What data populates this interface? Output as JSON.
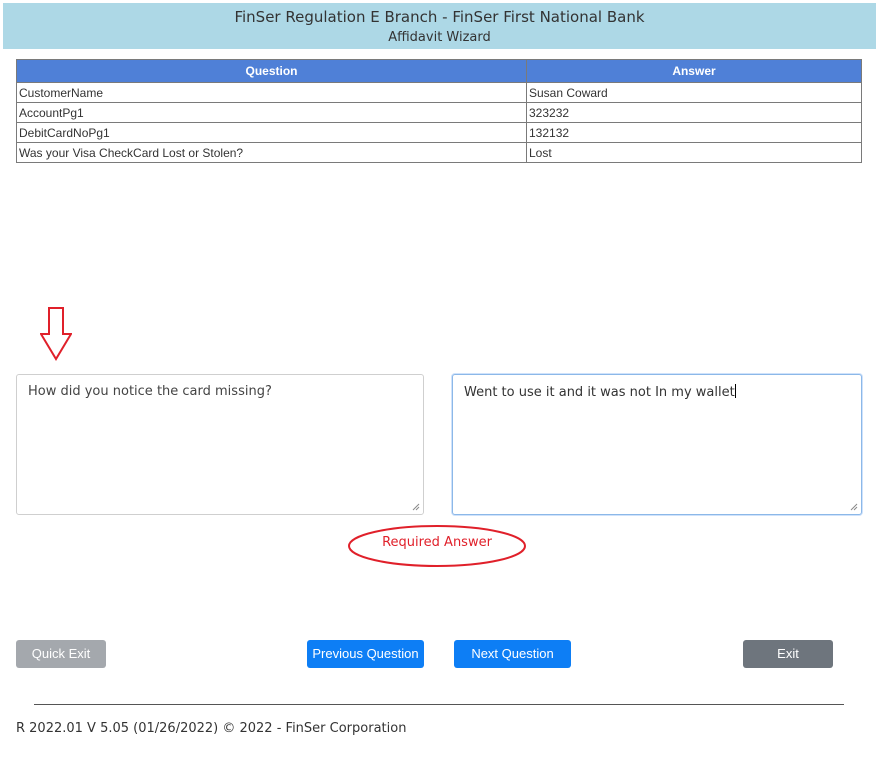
{
  "header": {
    "title": "FinSer Regulation E Branch - FinSer First National Bank",
    "subtitle": "Affidavit Wizard"
  },
  "table": {
    "columns": [
      "Question",
      "Answer"
    ],
    "rows": [
      {
        "question": "CustomerName",
        "answer": "Susan Coward"
      },
      {
        "question": "AccountPg1",
        "answer": "323232"
      },
      {
        "question": "DebitCardNoPg1",
        "answer": "132132"
      },
      {
        "question": "Was your Visa CheckCard Lost or Stolen?",
        "answer": "Lost"
      }
    ]
  },
  "current": {
    "question": "How did you notice the card missing?",
    "answer": "Went to use it and it was not In my wallet"
  },
  "validation": {
    "message": "Required Answer",
    "color": "#e0202a"
  },
  "buttons": {
    "quick_exit": "Quick Exit",
    "previous": "Previous Question",
    "next": "Next Question",
    "exit": "Exit"
  },
  "footer": {
    "text": "R 2022.01 V 5.05 (01/26/2022) © 2022 - FinSer Corporation"
  },
  "colors": {
    "header_bg": "#add8e6",
    "table_header_bg": "#4f80d7",
    "primary_button": "#0d7ef5",
    "quick_exit_button": "#a4a8ad",
    "exit_button": "#6e757d",
    "annotation_red": "#e0202a"
  },
  "icons": {
    "annotation": "down-arrow-icon"
  }
}
